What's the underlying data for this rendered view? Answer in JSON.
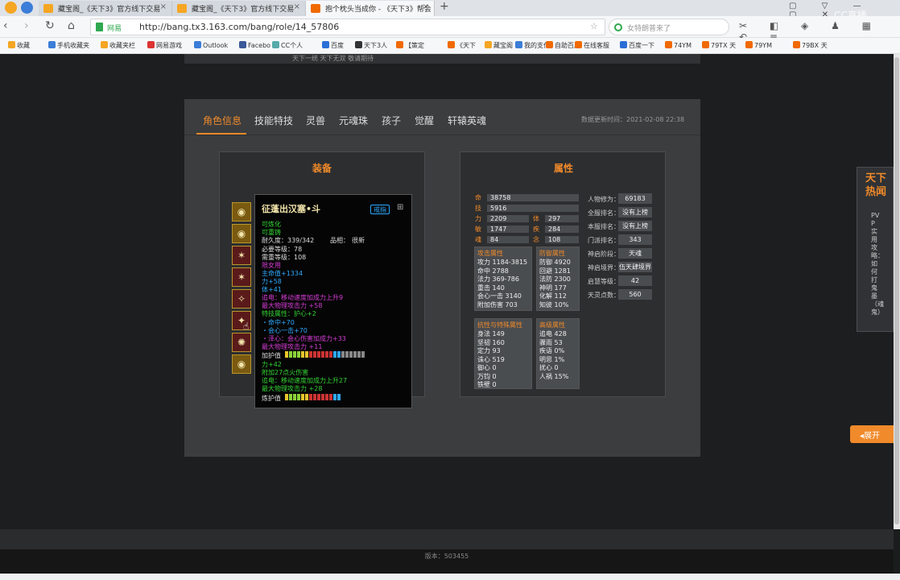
{
  "browser": {
    "tabs": [
      {
        "label": "藏宝阁_《天下3》官方线下交易",
        "color": "#f5a623"
      },
      {
        "label": "藏宝阁_《天下3》官方线下交易",
        "color": "#f5a623"
      },
      {
        "label": "抱个枕头当成你 - 《天下3》帮会",
        "color": "#f06a00"
      }
    ],
    "url": "http://bang.tx3.163.com/bang/role/14_57806",
    "site_label": "网易",
    "search_placeholder": "女特朗普来了",
    "watermark": "CC直播",
    "bookmarks": [
      "收藏",
      "手机收藏夹",
      "收藏夹栏",
      "网易游戏",
      "Outlook",
      "Facebo",
      "CC个人",
      "百度",
      "天下3人",
      "【策定",
      "《天下",
      "藏宝阁",
      "我的支付",
      "自助百度",
      "在线客服",
      "百度一下",
      "74YM",
      "79TX 天",
      "79YM",
      "79BX 天"
    ]
  },
  "page": {
    "top_hint": "天下一统 天下无双 敬请期待",
    "tabs": [
      "角色信息",
      "技能特技",
      "灵兽",
      "元魂珠",
      "孩子",
      "觉醒",
      "轩辕英魂"
    ],
    "update_label": "数据更新时间：2021-02-08 22:38",
    "equip_title": "装备",
    "attr_title": "属性",
    "slot_icons": [
      "◉",
      "◉",
      "✶",
      "✶",
      "✧",
      "✦",
      "✺",
      "◉"
    ]
  },
  "tooltip": {
    "name": "征蓬出汉塞•斗",
    "badge": "戒指",
    "lines": [
      {
        "t": "可炼化",
        "c": "#33d433"
      },
      {
        "t": "可重铸",
        "c": "#33d433"
      },
      {
        "t": "耐久度：339/342",
        "c": "#dddddd"
      },
      {
        "t": "必要等级：78",
        "c": "#dddddd"
      },
      {
        "t": "需重等级：108",
        "c": "#dddddd"
      },
      {
        "t": "限女用",
        "c": "#d63cd6"
      },
      {
        "t": "主命值+1334",
        "c": "#2ea9ff"
      },
      {
        "t": "力+58",
        "c": "#2ea9ff"
      },
      {
        "t": "体+41",
        "c": "#2ea9ff"
      },
      {
        "t": "追电：移动速度加成力上升9",
        "c": "#d63cd6"
      },
      {
        "t": "最大物理攻击力 +58",
        "c": "#d63cd6"
      },
      {
        "t": "特技属性：护心+2",
        "c": "#33d433"
      },
      {
        "t": "・命中+70",
        "c": "#2ea9ff"
      },
      {
        "t": "・会心一击+70",
        "c": "#2ea9ff"
      },
      {
        "t": "・泽心：会心伤害加成力+33",
        "c": "#d63cd6"
      },
      {
        "t": "最大物理攻击力 +11",
        "c": "#d63cd6"
      },
      {
        "t": "加护值",
        "c": "#dddddd"
      },
      {
        "t": "力+42",
        "c": "#33d433"
      },
      {
        "t": "附加27点火伤害",
        "c": "#33d433"
      },
      {
        "t": "追电：移动速度加成力上升27",
        "c": "#33d433"
      },
      {
        "t": "最大物理攻击力 +28",
        "c": "#33d433"
      },
      {
        "t": "炼护值",
        "c": "#dddddd"
      }
    ],
    "grade_label": "品相：",
    "grade_value": "很新"
  },
  "stats": {
    "main": [
      {
        "k": "命",
        "v": "38758"
      },
      {
        "k": "技",
        "v": "5916"
      }
    ],
    "pairs": [
      {
        "k1": "力",
        "v1": "2209",
        "k2": "体",
        "v2": "297"
      },
      {
        "k1": "敏",
        "v1": "1747",
        "k2": "疾",
        "v2": "284"
      },
      {
        "k1": "魂",
        "v1": "84",
        "k2": "念",
        "v2": "108"
      }
    ],
    "attack": {
      "title": "攻击属性",
      "rows": [
        "攻力 1184-3815",
        "命中 2788",
        "法力 369-786",
        "重击 140",
        "会心一击 3140",
        "附加伤害 703"
      ]
    },
    "defense": {
      "title": "防御属性",
      "rows": [
        "防御 4920",
        "回避 1281",
        "法防 2300",
        "神明 177",
        "化解 112",
        "知彼 10%"
      ]
    },
    "resist": {
      "title": "抗性与特殊属性",
      "rows": [
        "身法 149",
        "坚韧 160",
        "定力 93",
        "诛心 519",
        "御心 0",
        "万钧 0",
        "铁壁 0"
      ]
    },
    "advanced": {
      "title": "高级属性",
      "rows": [
        "追电 428",
        "骤雨 53",
        "疾语 0%",
        "明思 1%",
        "扰心 0",
        "人祸 15%"
      ]
    },
    "ranks": [
      {
        "k": "人物修为：",
        "v": "69183"
      },
      {
        "k": "全服排名：",
        "v": "没有上榜"
      },
      {
        "k": "本服排名：",
        "v": "没有上榜"
      },
      {
        "k": "门派排名：",
        "v": "343"
      },
      {
        "k": "神启阶段：",
        "v": "天魂"
      },
      {
        "k": "神启境界：",
        "v": "伍天肆境界"
      },
      {
        "k": "启慧等级：",
        "v": "42"
      },
      {
        "k": "天灵点数：",
        "v": "560"
      }
    ]
  },
  "side": {
    "title": "天下热闻",
    "text": "PVP实用攻略：如何打鬼墨（魂鬼）",
    "expand": "◂展开"
  },
  "footer": {
    "version": "版本：503455"
  }
}
